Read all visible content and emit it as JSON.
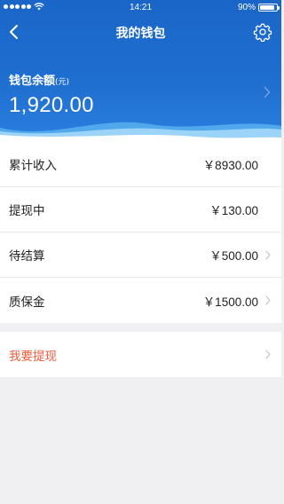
{
  "status_bar": {
    "time": "14:21",
    "battery": "90%",
    "battery_level": 0.9
  },
  "nav": {
    "title": "我的钱包",
    "back_icon": "chevron-left-icon",
    "settings_icon": "gear-icon"
  },
  "balance": {
    "label": "钱包余额",
    "unit": "(元)",
    "amount": "1,920.00"
  },
  "rows": [
    {
      "label": "累计收入",
      "value": "￥8930.00",
      "chevron": false
    },
    {
      "label": "提现中",
      "value": "￥130.00",
      "chevron": false
    },
    {
      "label": "待结算",
      "value": "￥500.00",
      "chevron": true
    },
    {
      "label": "质保金",
      "value": "￥1500.00",
      "chevron": true
    }
  ],
  "withdraw": {
    "label": "我要提现"
  },
  "colors": {
    "header_blue": "#1f6fd0",
    "accent_red": "#f05a3c",
    "background": "#f0f0f2"
  }
}
